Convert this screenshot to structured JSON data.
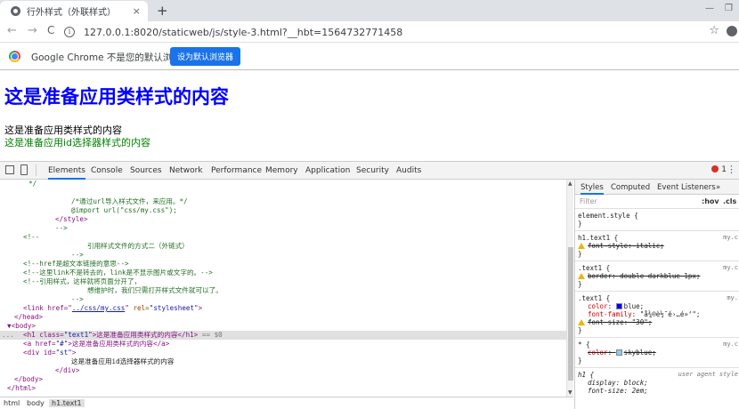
{
  "browser": {
    "tab_title": "行外样式（外联样式）",
    "tab_close": "×",
    "new_tab": "+",
    "win_min": "—",
    "win_max": "❐",
    "back": "←",
    "forward": "→",
    "reload": "C",
    "url": "127.0.0.1:8020/staticweb/js/style-3.html?__hbt=1564732771458",
    "info_icon": "i",
    "star": "☆"
  },
  "infobar": {
    "text": "Google Chrome 不是您的默认浏览器",
    "button": "设为默认浏览器"
  },
  "page": {
    "heading": "这是准备应用类样式的内容",
    "line1": "这是准备应用类样式的内容",
    "line2": "这是准备应用id选择器样式的内容"
  },
  "devtools": {
    "tabs": [
      "Elements",
      "Console",
      "Sources",
      "Network",
      "Performance",
      "Memory",
      "Application",
      "Security",
      "Audits"
    ],
    "error_count": "1",
    "more": "⋮",
    "elements_lines": [
      {
        "indent": 32,
        "cls": "cm",
        "text": "*/"
      },
      {
        "indent": 0,
        "cls": "",
        "text": ""
      },
      {
        "indent": 80,
        "cls": "cm",
        "text": "/*通过url导入样式文件，来应用。*/"
      },
      {
        "indent": 80,
        "cls": "cm",
        "text": "@import url(\"css/my.css\");"
      },
      {
        "indent": 62,
        "cls": "tg",
        "text": "</style>"
      },
      {
        "indent": 62,
        "cls": "cm",
        "text": "-->"
      },
      {
        "indent": 26,
        "cls": "cm",
        "text": "<!--"
      },
      {
        "indent": 98,
        "cls": "cm",
        "text": "引用样式文件的方式二（外链式）"
      },
      {
        "indent": 80,
        "cls": "cm",
        "text": "-->"
      },
      {
        "indent": 26,
        "cls": "cm",
        "text": "<!--href是超文本链接的意思-->"
      },
      {
        "indent": 26,
        "cls": "cm",
        "text": "<!--这里link不是转去的，link是不显示图片或文字的。-->"
      },
      {
        "indent": 26,
        "cls": "cm",
        "text": "<!--引用样式，这样就将页面分开了，"
      },
      {
        "indent": 98,
        "cls": "cm",
        "text": "想维护时，我们只需打开样式文件就可以了。"
      },
      {
        "indent": 80,
        "cls": "cm",
        "text": "-->"
      }
    ],
    "link_open": "<link href=\"",
    "link_href": "../css/my.css",
    "link_rel_attr": " rel=",
    "link_rel_val": "\"stylesheet\"",
    "link_close": ">",
    "head_close": "</head>",
    "body_open": "▼<body>",
    "dots": "...",
    "h1_open": "<h1 class=",
    "h1_class": "\"text1\"",
    "h1_text": ">这是准备应用类样式的内容</h1>",
    "h1_eq": " == $0",
    "a_open": "<a href=",
    "a_href": "\"#\"",
    "a_text": ">这是准备应用类样式的内容</a>",
    "div_open": "<div id=",
    "div_id": "\"st\"",
    "div_gt": ">",
    "div_text": "这是准备应用id选择器样式的内容",
    "div_close": "</div>",
    "body_close": "</body>",
    "html_close": "</html>",
    "breadcrumbs": [
      "html",
      "body",
      "h1.text1"
    ],
    "styles_tabs": [
      "Styles",
      "Computed",
      "Event Listeners",
      "»"
    ],
    "filter_placeholder": "Filter",
    "hov": ":hov",
    "cls": ".cls",
    "rules": {
      "element_style": "element.style {",
      "close": "}",
      "r1_sel": "h1.text1 {",
      "r1_src": "my.c",
      "r1_prop": "font-style: italic;",
      "r2_sel": ".text1 {",
      "r2_src": "my.c",
      "r2_prop": "border: double darkblue 1px;",
      "r3_sel": ".text1 {",
      "r3_src": "my.",
      "r3_color_name": "color",
      "r3_color_val": "blue;",
      "r3_font_name": "font-family",
      "r3_font_val": "\"å¾®è½¯é›…é»‘\";",
      "r3_size": "font-size: \"30\";",
      "r4_sel": "* {",
      "r4_src": "my.c",
      "r4_prop_name": "color",
      "r4_prop_val": "skyblue;",
      "r5_sel": "h1 {",
      "r5_src": "user agent style",
      "r5_display": "display: block;",
      "r5_size": "font-size: 2em;"
    },
    "colors": {
      "blue": "#0000ff",
      "skyblue": "#87ceeb"
    }
  }
}
